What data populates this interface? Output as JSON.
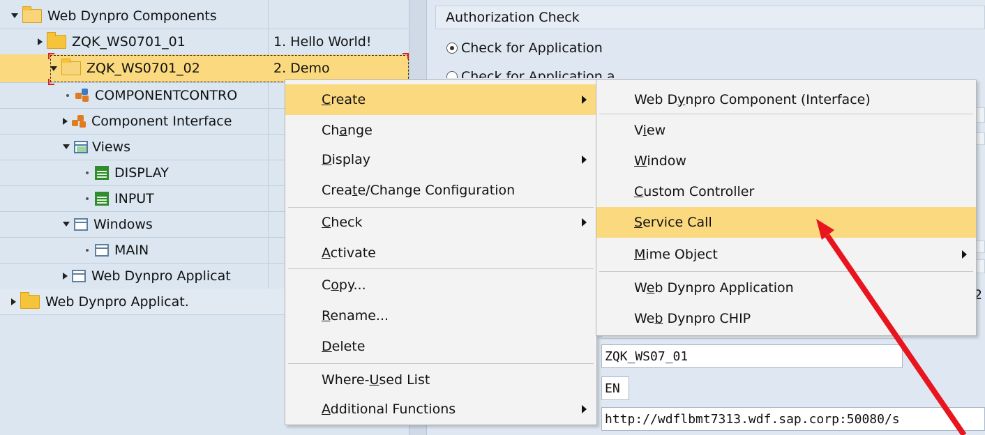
{
  "tree": {
    "rows": [
      {
        "label": "Web Dynpro Components",
        "desc": ""
      },
      {
        "label": "ZQK_WS0701_01",
        "desc": "1. Hello World!"
      },
      {
        "label": "ZQK_WS0701_02",
        "desc": "2. Demo"
      },
      {
        "label": "COMPONENTCONTRO",
        "desc": ""
      },
      {
        "label": "Component Interface",
        "desc": ""
      },
      {
        "label": "Views",
        "desc": ""
      },
      {
        "label": "DISPLAY",
        "desc": ""
      },
      {
        "label": "INPUT",
        "desc": ""
      },
      {
        "label": "Windows",
        "desc": ""
      },
      {
        "label": "MAIN",
        "desc": ""
      },
      {
        "label": "Web Dynpro Applicat",
        "desc": ""
      },
      {
        "label": "Web Dynpro Applicat.",
        "desc": ""
      }
    ]
  },
  "right": {
    "header": "Authorization Check",
    "radio1": "Check for Application",
    "radio2": "Check for Application and Application Configuration",
    "field1": "ZQK_WS07_01",
    "field2": "EN",
    "field3": "http://wdflbmt7313.wdf.sap.corp:50080/s",
    "clip_char": "2"
  },
  "context_menu": {
    "items": [
      {
        "pre": "",
        "u": "C",
        "post": "reate",
        "submenu": true
      },
      {
        "pre": "Ch",
        "u": "a",
        "post": "nge",
        "submenu": false
      },
      {
        "pre": "",
        "u": "D",
        "post": "isplay",
        "submenu": true
      },
      {
        "pre": "Crea",
        "u": "t",
        "post": "e/Change Configuration",
        "submenu": false
      },
      {
        "pre": "",
        "u": "C",
        "post": "heck",
        "submenu": true
      },
      {
        "pre": "",
        "u": "A",
        "post": "ctivate",
        "submenu": false
      },
      {
        "pre": "C",
        "u": "o",
        "post": "py...",
        "submenu": false
      },
      {
        "pre": "",
        "u": "R",
        "post": "ename...",
        "submenu": false
      },
      {
        "pre": "",
        "u": "D",
        "post": "elete",
        "submenu": false
      },
      {
        "pre": "Where-",
        "u": "U",
        "post": "sed List",
        "submenu": false
      },
      {
        "pre": "",
        "u": "A",
        "post": "dditional Functions",
        "submenu": true
      }
    ]
  },
  "submenu": {
    "items": [
      {
        "pre": "Web D",
        "u": "y",
        "post": "npro Component (Interface)",
        "submenu": false
      },
      {
        "pre": "V",
        "u": "i",
        "post": "ew",
        "submenu": false
      },
      {
        "pre": "",
        "u": "W",
        "post": "indow",
        "submenu": false
      },
      {
        "pre": "",
        "u": "C",
        "post": "ustom Controller",
        "submenu": false
      },
      {
        "pre": "",
        "u": "S",
        "post": "ervice Call",
        "submenu": false
      },
      {
        "pre": "",
        "u": "M",
        "post": "ime Object",
        "submenu": true
      },
      {
        "pre": "W",
        "u": "e",
        "post": "b Dynpro Application",
        "submenu": false
      },
      {
        "pre": "We",
        "u": "b",
        "post": " Dynpro CHIP",
        "submenu": false
      }
    ]
  },
  "colors": {
    "highlight": "#fbd97e",
    "arrow": "#e8141e",
    "panel": "#dbe6f1"
  }
}
